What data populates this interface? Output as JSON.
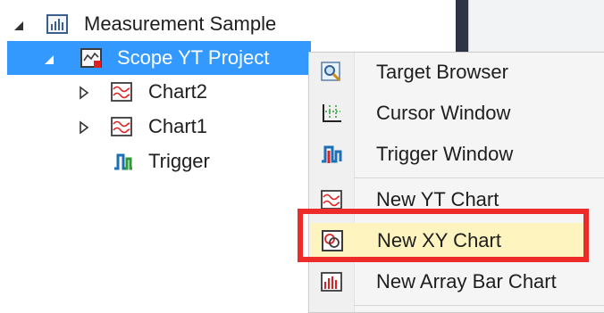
{
  "tree": {
    "root": {
      "label": "Measurement Sample",
      "icon": "measurement-sample-icon",
      "expanded": true
    },
    "project": {
      "label": "Scope YT Project",
      "icon": "scope-project-icon",
      "expanded": true
    },
    "children": [
      {
        "label": "Chart2",
        "icon": "yt-chart-icon",
        "expandable": true
      },
      {
        "label": "Chart1",
        "icon": "yt-chart-icon",
        "expandable": true
      },
      {
        "label": "Trigger",
        "icon": "trigger-icon",
        "expandable": false
      }
    ]
  },
  "context_menu": {
    "items": [
      {
        "label": "Target Browser",
        "icon": "target-browser-icon"
      },
      {
        "label": "Cursor Window",
        "icon": "cursor-window-icon"
      },
      {
        "label": "Trigger Window",
        "icon": "trigger-window-icon"
      },
      {
        "label": "New YT Chart",
        "icon": "yt-chart-icon"
      },
      {
        "label": "New XY Chart",
        "icon": "xy-chart-icon",
        "highlighted": true
      },
      {
        "label": "New Array Bar Chart",
        "icon": "array-bar-chart-icon"
      }
    ]
  },
  "colors": {
    "selection": "#3399ff",
    "highlight": "#fdf4bf",
    "annotation_box": "#ee2b2b"
  }
}
